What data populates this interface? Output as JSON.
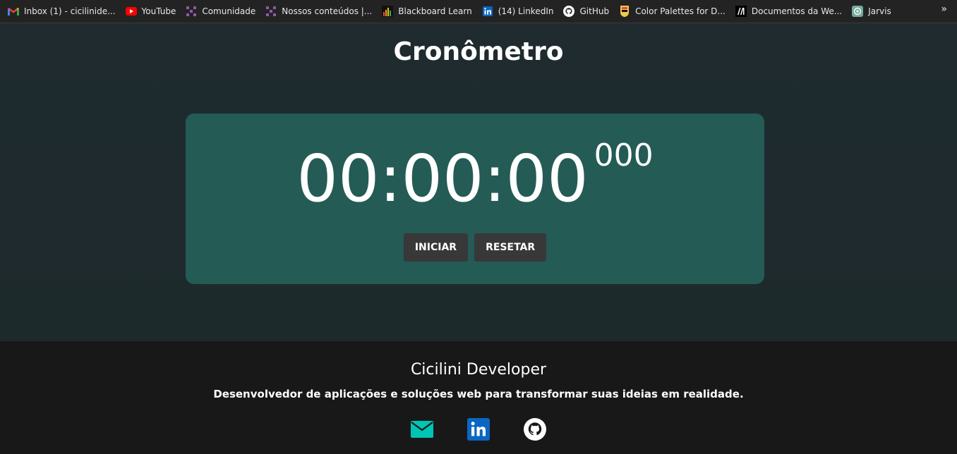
{
  "bookmarks": [
    {
      "label": "Inbox (1) - cicilinide...",
      "icon": "gmail-icon"
    },
    {
      "label": "YouTube",
      "icon": "youtube-icon"
    },
    {
      "label": "Comunidade",
      "icon": "community-icon"
    },
    {
      "label": "Nossos conteúdos |...",
      "icon": "community-icon"
    },
    {
      "label": "Blackboard Learn",
      "icon": "blackboard-icon"
    },
    {
      "label": "(14) LinkedIn",
      "icon": "linkedin-icon"
    },
    {
      "label": "GitHub",
      "icon": "github-icon"
    },
    {
      "label": "Color Palettes for D...",
      "icon": "palette-icon"
    },
    {
      "label": "Documentos da We...",
      "icon": "mdn-icon"
    },
    {
      "label": "Jarvis",
      "icon": "chatgpt-icon"
    }
  ],
  "bookmarks_more": "»",
  "page": {
    "title": "Cronômetro"
  },
  "timer": {
    "display": "00:00:00",
    "milliseconds": "000",
    "start_label": "INICIAR",
    "reset_label": "RESETAR"
  },
  "footer": {
    "title": "Cicilini Developer",
    "description": "Desenvolvedor de aplicações e soluções web para transformar suas ideias em realidade.",
    "socials": [
      "email-icon",
      "linkedin-icon",
      "github-icon"
    ]
  },
  "colors": {
    "card": "#245b55",
    "background": "#1c2a2e",
    "footer": "#181818",
    "button": "#383838",
    "email_icon": "#00c4b4",
    "linkedin": "#0a66c2"
  }
}
